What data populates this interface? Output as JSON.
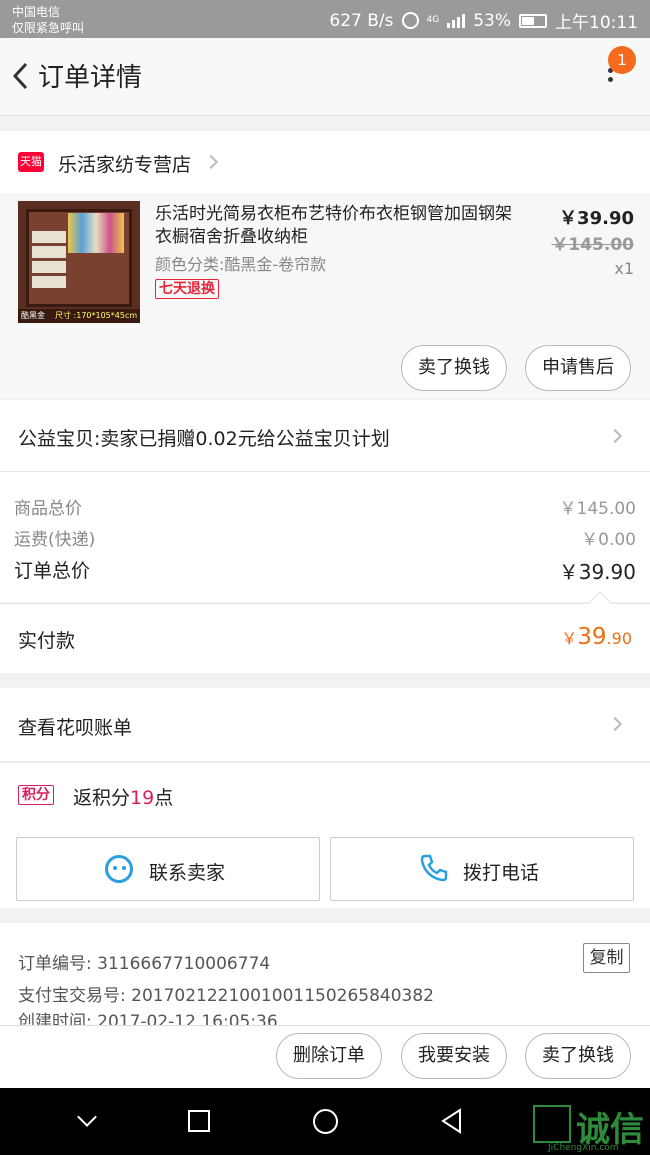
{
  "status_bar": {
    "carrier": "中国电信",
    "carrier_note": "仅限紧急呼叫",
    "net_speed": "627 B/s",
    "network": "4G",
    "battery": "53%",
    "time": "上午10:11"
  },
  "nav": {
    "title": "订单详情",
    "badge_count": "1"
  },
  "shop": {
    "badge": "天猫",
    "name": "乐活家纺专营店"
  },
  "item": {
    "image_caption": "酷黑金",
    "image_size": "尺寸 :170*105*45cm",
    "title": "乐活时光简易衣柜布艺特价布衣柜钢管加固钢架衣橱宿舍折叠收纳柜",
    "sku": "颜色分类:酷黑金-卷帘款",
    "tag": "七天退换",
    "price": "￥39.90",
    "original_price": "￥145.00",
    "quantity": "x1",
    "actions": [
      "卖了换钱",
      "申请售后"
    ]
  },
  "charity": {
    "text": "公益宝贝:卖家已捐赠0.02元给公益宝贝计划"
  },
  "summary": {
    "goods_total_label": "商品总价",
    "goods_total_value": "￥145.00",
    "shipping_label": "运费(快递)",
    "shipping_value": "￥0.00",
    "order_total_label": "订单总价",
    "order_total_value": "￥39.90"
  },
  "paid": {
    "label": "实付款",
    "currency": "￥",
    "integer": "39",
    "decimal": ".90"
  },
  "huabei": {
    "text": "查看花呗账单"
  },
  "points": {
    "tag": "积分",
    "prefix": "返积分",
    "value": "19",
    "suffix": "点"
  },
  "contact": {
    "seller_label": "联系卖家",
    "call_label": "拨打电话"
  },
  "order_info": {
    "order_no_label": "订单编号:",
    "order_no": "3116667710006774",
    "alipay_no_label": "支付宝交易号:",
    "alipay_no": "2017021221001001150265840382",
    "created_label": "创建时间:",
    "created": "2017-02-12 16:05:36",
    "copy_label": "复制"
  },
  "bottom_actions": [
    "删除订单",
    "我要安装",
    "卖了换钱"
  ],
  "watermark": {
    "text": "诚信",
    "sub": "JiChengXin.com"
  },
  "colors": {
    "accent_orange": "#f26d10",
    "tmall_red": "#ff0036",
    "points_pink": "#d81e5b",
    "contact_blue": "#2a9fe0"
  }
}
